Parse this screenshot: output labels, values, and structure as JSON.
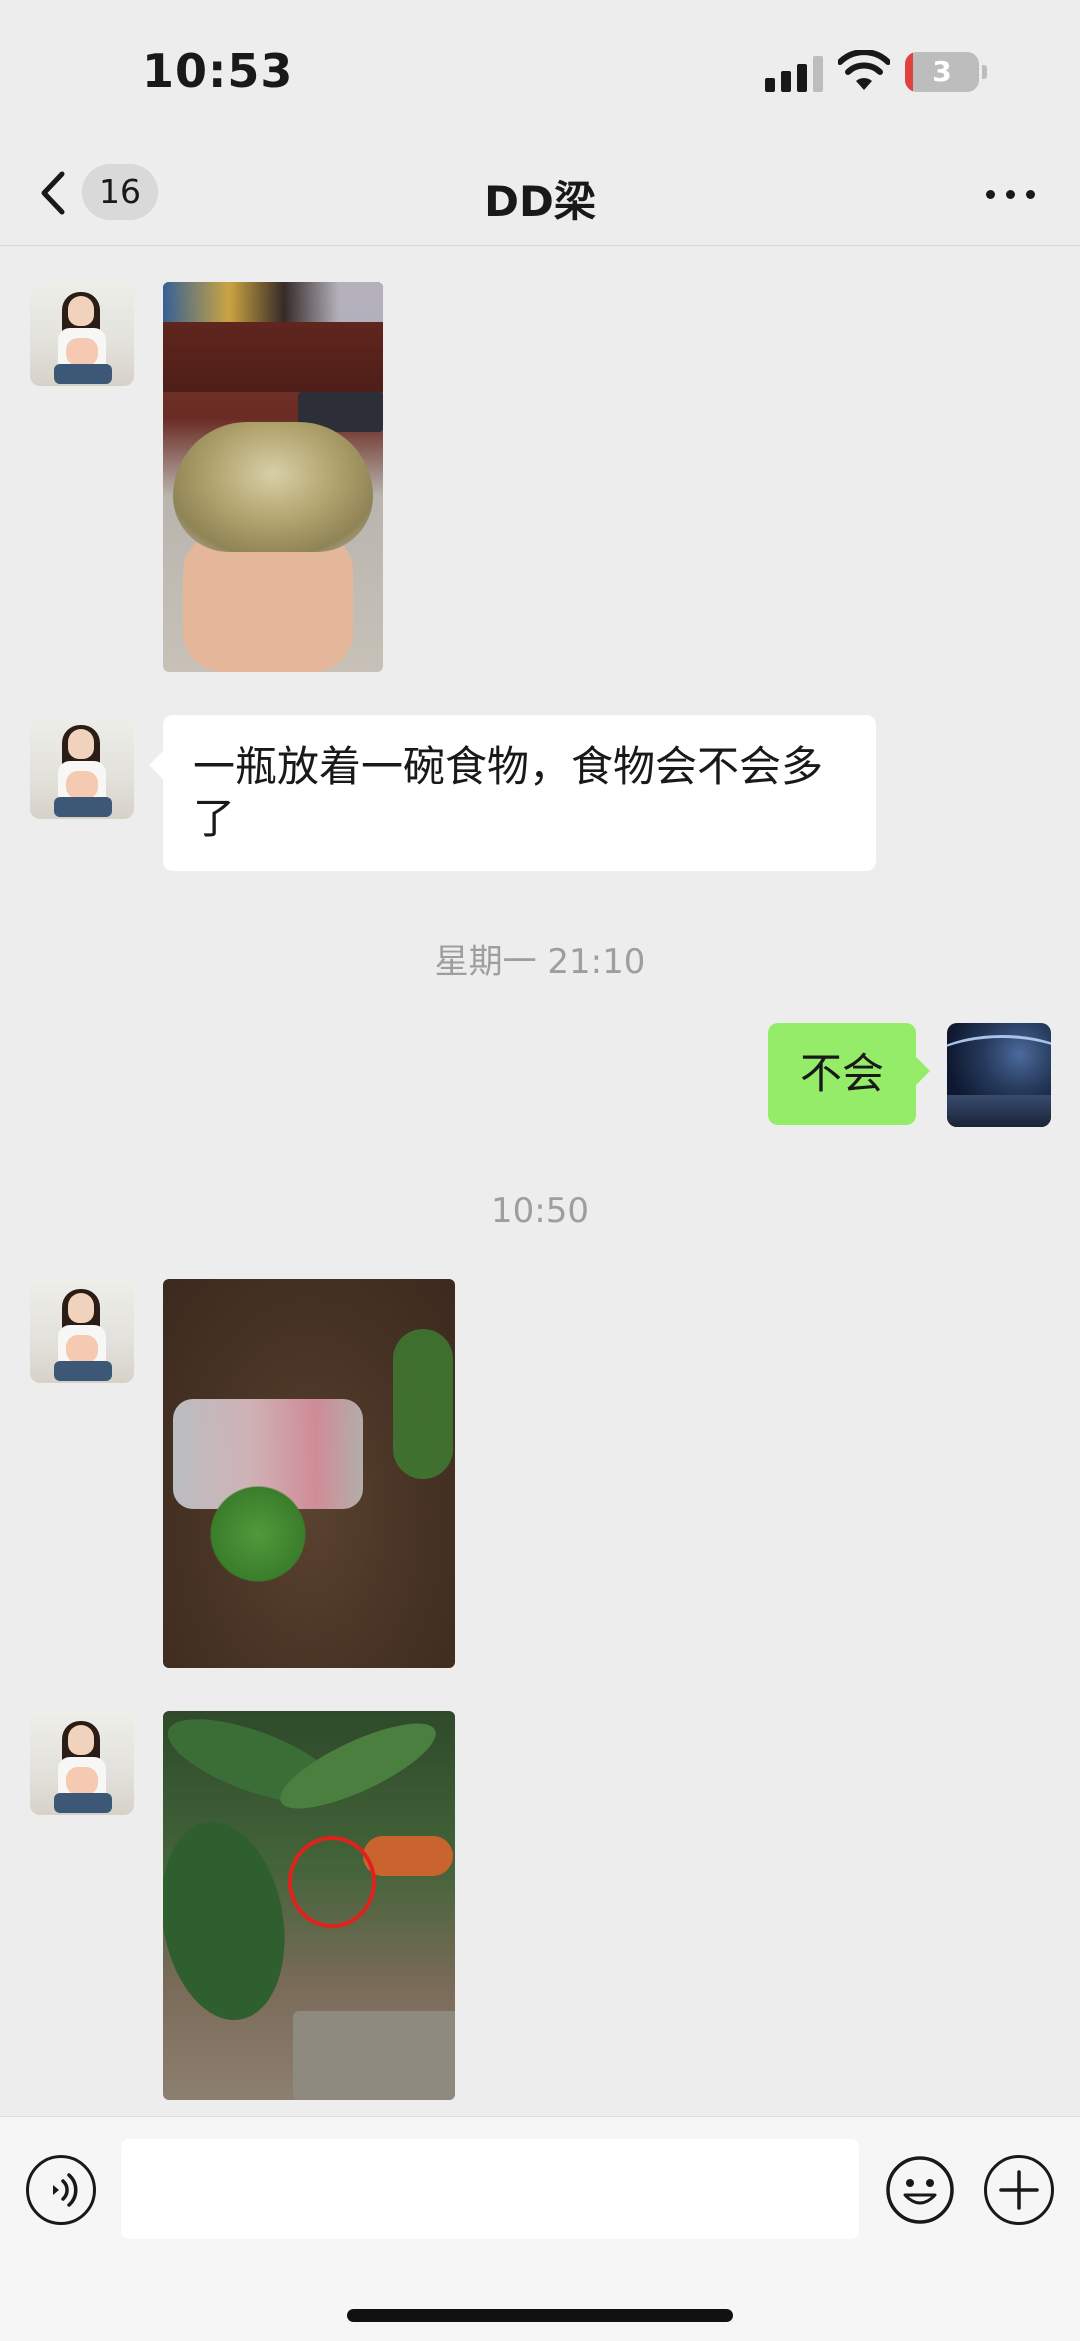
{
  "status_bar": {
    "time": "10:53",
    "battery_level": "3",
    "battery_color": "#e0433f"
  },
  "header": {
    "back_icon": "chevron-left-icon",
    "unread_count": "16",
    "title": "DD梁",
    "more_icon": "more-horizontal-icon"
  },
  "messages": {
    "m1": {
      "sender": "contact",
      "type": "image",
      "description_icon": "photo-food-cup"
    },
    "m2": {
      "sender": "contact",
      "type": "text",
      "text": "一瓶放着一碗食物，食物会不会多了"
    },
    "t1": {
      "type": "timestamp",
      "text": "星期一 21:10"
    },
    "m3": {
      "sender": "self",
      "type": "text",
      "text": "不会"
    },
    "t2": {
      "type": "timestamp",
      "text": "10:50"
    },
    "m4": {
      "sender": "contact",
      "type": "image",
      "description_icon": "photo-plant-trash"
    },
    "m5": {
      "sender": "contact",
      "type": "image",
      "description_icon": "photo-palm-circled"
    }
  },
  "input_bar": {
    "voice_icon": "voice-icon",
    "text_value": "",
    "emoji_icon": "emoji-icon",
    "plus_icon": "plus-circle-icon"
  },
  "colors": {
    "background": "#ededed",
    "outgoing_bubble": "#95ec69",
    "incoming_bubble": "#ffffff",
    "timestamp_text": "#9e9e9e"
  }
}
